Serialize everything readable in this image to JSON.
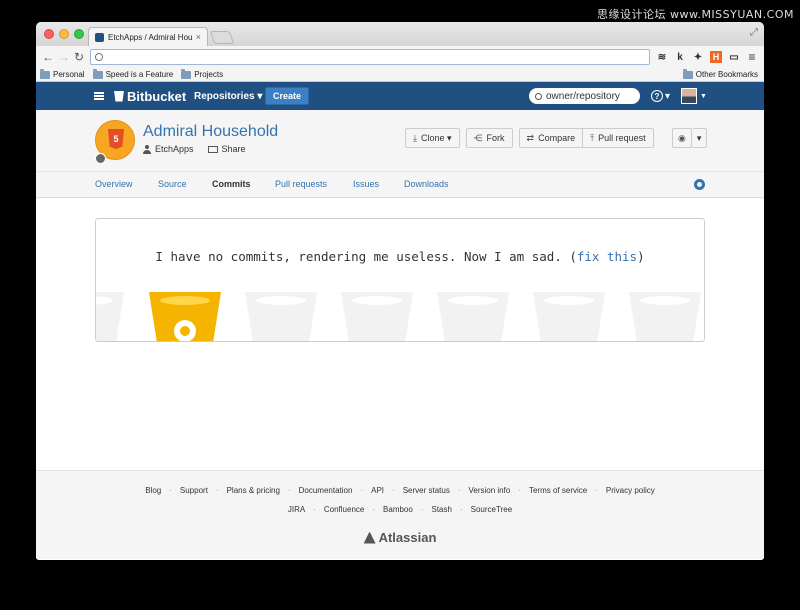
{
  "watermark": "思缘设计论坛 www.MISSYUAN.COM",
  "browser": {
    "tab_title": "EtchApps / Admiral House",
    "tab_close": "×",
    "omnibox_value": "",
    "bookmarks": [
      "Personal",
      "Speed is a Feature",
      "Projects"
    ],
    "other_bookmarks": "Other Bookmarks",
    "ext_k": "k",
    "ext_h": "H"
  },
  "header": {
    "brand": "Bitbucket",
    "repositories": "Repositories ▾",
    "create": "Create",
    "search_placeholder": "owner/repository",
    "help_caret": "▾"
  },
  "repo": {
    "title": "Admiral Household",
    "owner": "EtchApps",
    "share": "Share",
    "html5_badge": "5",
    "actions": {
      "clone": "Clone ▾",
      "fork": "Fork",
      "compare": "Compare",
      "pull_request": "Pull request",
      "watch_caret": "▾"
    }
  },
  "tabs": [
    "Overview",
    "Source",
    "Commits",
    "Pull requests",
    "Issues",
    "Downloads"
  ],
  "active_tab": "Commits",
  "empty_state": {
    "message": "I have no commits, rendering me useless. Now I am sad. (",
    "link": "fix this",
    "close_paren": ")"
  },
  "footer": {
    "row1": [
      "Blog",
      "Support",
      "Plans & pricing",
      "Documentation",
      "API",
      "Server status",
      "Version info",
      "Terms of service",
      "Privacy policy"
    ],
    "row2": [
      "JIRA",
      "Confluence",
      "Bamboo",
      "Stash",
      "SourceTree"
    ],
    "brand": "Atlassian"
  },
  "colors": {
    "header_bg": "#205081",
    "link": "#3572b0",
    "create_btn": "#3b7fc4",
    "bucket_yellow": "#f4b400"
  }
}
